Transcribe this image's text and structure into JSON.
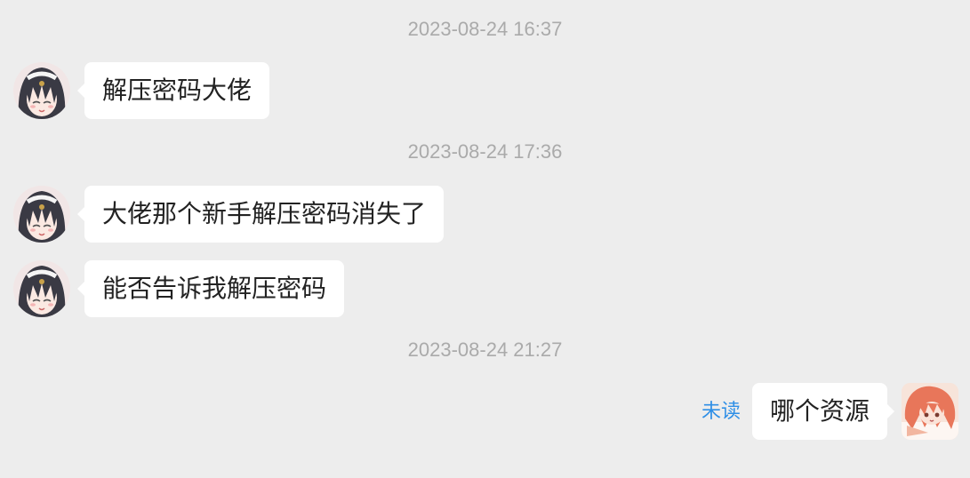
{
  "messages": [
    {
      "timestamp": "2023-08-24 16:37",
      "text": "解压密码大佬"
    },
    {
      "timestamp": "2023-08-24 17:36",
      "text": "大佬那个新手解压密码消失了"
    },
    {
      "text": "能否告诉我解压密码"
    },
    {
      "timestamp": "2023-08-24 21:27",
      "text": "哪个资源",
      "status": "未读"
    }
  ],
  "colors": {
    "background": "#ededed",
    "bubble": "#ffffff",
    "timestamp": "#aaaaaa",
    "unread": "#2f8fe6"
  }
}
